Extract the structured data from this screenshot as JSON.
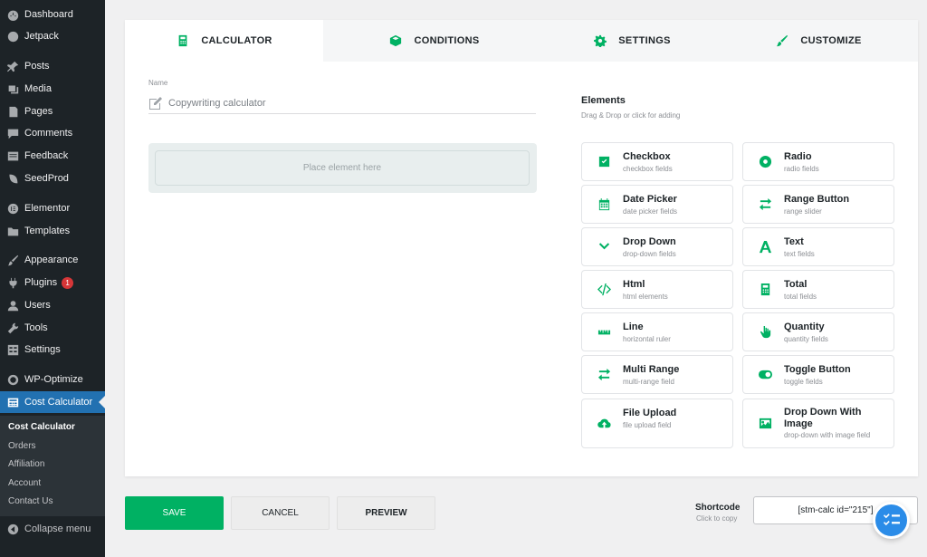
{
  "sidebar": {
    "items": [
      {
        "label": "Dashboard",
        "icon": "dashboard-icon"
      },
      {
        "label": "Jetpack",
        "icon": "jetpack-icon"
      },
      {
        "label": "Posts",
        "icon": "pin-icon"
      },
      {
        "label": "Media",
        "icon": "media-icon"
      },
      {
        "label": "Pages",
        "icon": "pages-icon"
      },
      {
        "label": "Comments",
        "icon": "comments-icon"
      },
      {
        "label": "Feedback",
        "icon": "feedback-icon"
      },
      {
        "label": "SeedProd",
        "icon": "seedprod-icon"
      },
      {
        "label": "Elementor",
        "icon": "elementor-icon"
      },
      {
        "label": "Templates",
        "icon": "folder-icon"
      },
      {
        "label": "Appearance",
        "icon": "brush-icon"
      },
      {
        "label": "Plugins",
        "icon": "plug-icon",
        "badge": "1"
      },
      {
        "label": "Users",
        "icon": "user-icon"
      },
      {
        "label": "Tools",
        "icon": "wrench-icon"
      },
      {
        "label": "Settings",
        "icon": "settings-icon"
      },
      {
        "label": "WP-Optimize",
        "icon": "optimize-icon"
      },
      {
        "label": "Cost Calculator",
        "icon": "calculator-icon",
        "active": true
      }
    ],
    "submenu": [
      "Cost Calculator",
      "Orders",
      "Affiliation",
      "Account",
      "Contact Us"
    ],
    "collapse_label": "Collapse menu"
  },
  "tabs": [
    {
      "label": "CALCULATOR",
      "icon": "calculator-icon",
      "active": true
    },
    {
      "label": "CONDITIONS",
      "icon": "cube-icon"
    },
    {
      "label": "SETTINGS",
      "icon": "gear-icon"
    },
    {
      "label": "CUSTOMIZE",
      "icon": "brush-icon"
    }
  ],
  "name": {
    "label": "Name",
    "value": "Copywriting calculator"
  },
  "drop_placeholder": "Place element here",
  "elements": {
    "title": "Elements",
    "subtitle": "Drag & Drop or click for adding",
    "items": [
      {
        "title": "Checkbox",
        "desc": "checkbox fields",
        "icon": "checkbox-icon"
      },
      {
        "title": "Radio",
        "desc": "radio fields",
        "icon": "radio-icon"
      },
      {
        "title": "Date Picker",
        "desc": "date picker fields",
        "icon": "calendar-icon"
      },
      {
        "title": "Range Button",
        "desc": "range slider",
        "icon": "arrows-icon"
      },
      {
        "title": "Drop Down",
        "desc": "drop-down fields",
        "icon": "chevron-down-icon"
      },
      {
        "title": "Text",
        "desc": "text fields",
        "icon": "text-icon"
      },
      {
        "title": "Html",
        "desc": "html elements",
        "icon": "code-icon"
      },
      {
        "title": "Total",
        "desc": "total fields",
        "icon": "calculator-icon"
      },
      {
        "title": "Line",
        "desc": "horizontal ruler",
        "icon": "ruler-icon"
      },
      {
        "title": "Quantity",
        "desc": "quantity fields",
        "icon": "hand-icon"
      },
      {
        "title": "Multi Range",
        "desc": "multi-range field",
        "icon": "arrows-icon"
      },
      {
        "title": "Toggle Button",
        "desc": "toggle fields",
        "icon": "toggle-icon"
      },
      {
        "title": "File Upload",
        "desc": "file upload field",
        "icon": "cloud-upload-icon"
      },
      {
        "title": "Drop Down With Image",
        "desc": "drop-down with image field",
        "icon": "image-icon"
      }
    ]
  },
  "buttons": {
    "save": "SAVE",
    "cancel": "CANCEL",
    "preview": "PREVIEW"
  },
  "shortcode": {
    "label": "Shortcode",
    "hint": "Click to copy",
    "value": "[stm-calc id=\"215\"]"
  },
  "colors": {
    "accent": "#00b163",
    "sidebar_bg": "#1d2327",
    "active_menu": "#2271b1",
    "fab": "#2b8ce8"
  }
}
